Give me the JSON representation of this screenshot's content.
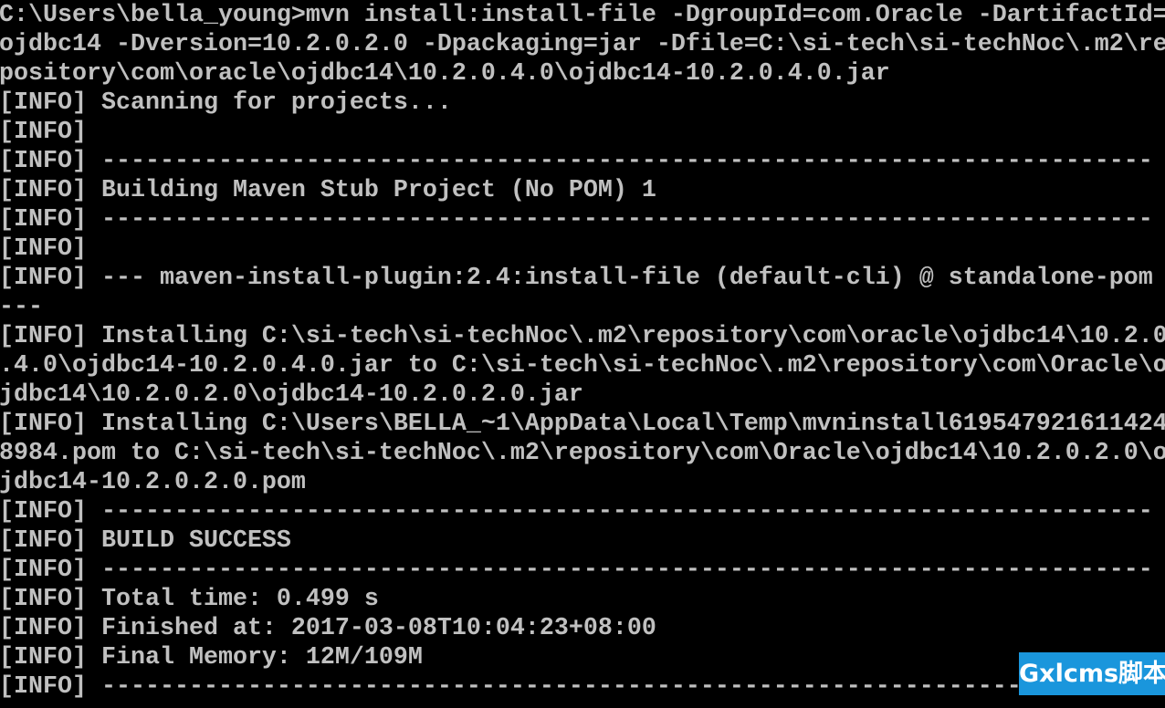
{
  "console": {
    "lines": [
      "C:\\Users\\bella_young>mvn install:install-file -DgroupId=com.Oracle -DartifactId=",
      "ojdbc14 -Dversion=10.2.0.2.0 -Dpackaging=jar -Dfile=C:\\si-tech\\si-techNoc\\.m2\\re",
      "pository\\com\\oracle\\ojdbc14\\10.2.0.4.0\\ojdbc14-10.2.0.4.0.jar",
      "[INFO] Scanning for projects...",
      "[INFO]",
      "[INFO] ------------------------------------------------------------------------",
      "[INFO] Building Maven Stub Project (No POM) 1",
      "[INFO] ------------------------------------------------------------------------",
      "[INFO]",
      "[INFO] --- maven-install-plugin:2.4:install-file (default-cli) @ standalone-pom",
      "---",
      "[INFO] Installing C:\\si-tech\\si-techNoc\\.m2\\repository\\com\\oracle\\ojdbc14\\10.2.0",
      ".4.0\\ojdbc14-10.2.0.4.0.jar to C:\\si-tech\\si-techNoc\\.m2\\repository\\com\\Oracle\\o",
      "jdbc14\\10.2.0.2.0\\ojdbc14-10.2.0.2.0.jar",
      "[INFO] Installing C:\\Users\\BELLA_~1\\AppData\\Local\\Temp\\mvninstall619547921611424",
      "8984.pom to C:\\si-tech\\si-techNoc\\.m2\\repository\\com\\Oracle\\ojdbc14\\10.2.0.2.0\\o",
      "jdbc14-10.2.0.2.0.pom",
      "[INFO] ------------------------------------------------------------------------",
      "[INFO] BUILD SUCCESS",
      "[INFO] ------------------------------------------------------------------------",
      "[INFO] Total time: 0.499 s",
      "[INFO] Finished at: 2017-03-08T10:04:23+08:00",
      "[INFO] Final Memory: 12M/109M",
      "[INFO] ------------------------------------------------------------------------"
    ]
  },
  "watermark": {
    "text": "Gxlcms脚本",
    "color": "#1a96dc"
  }
}
